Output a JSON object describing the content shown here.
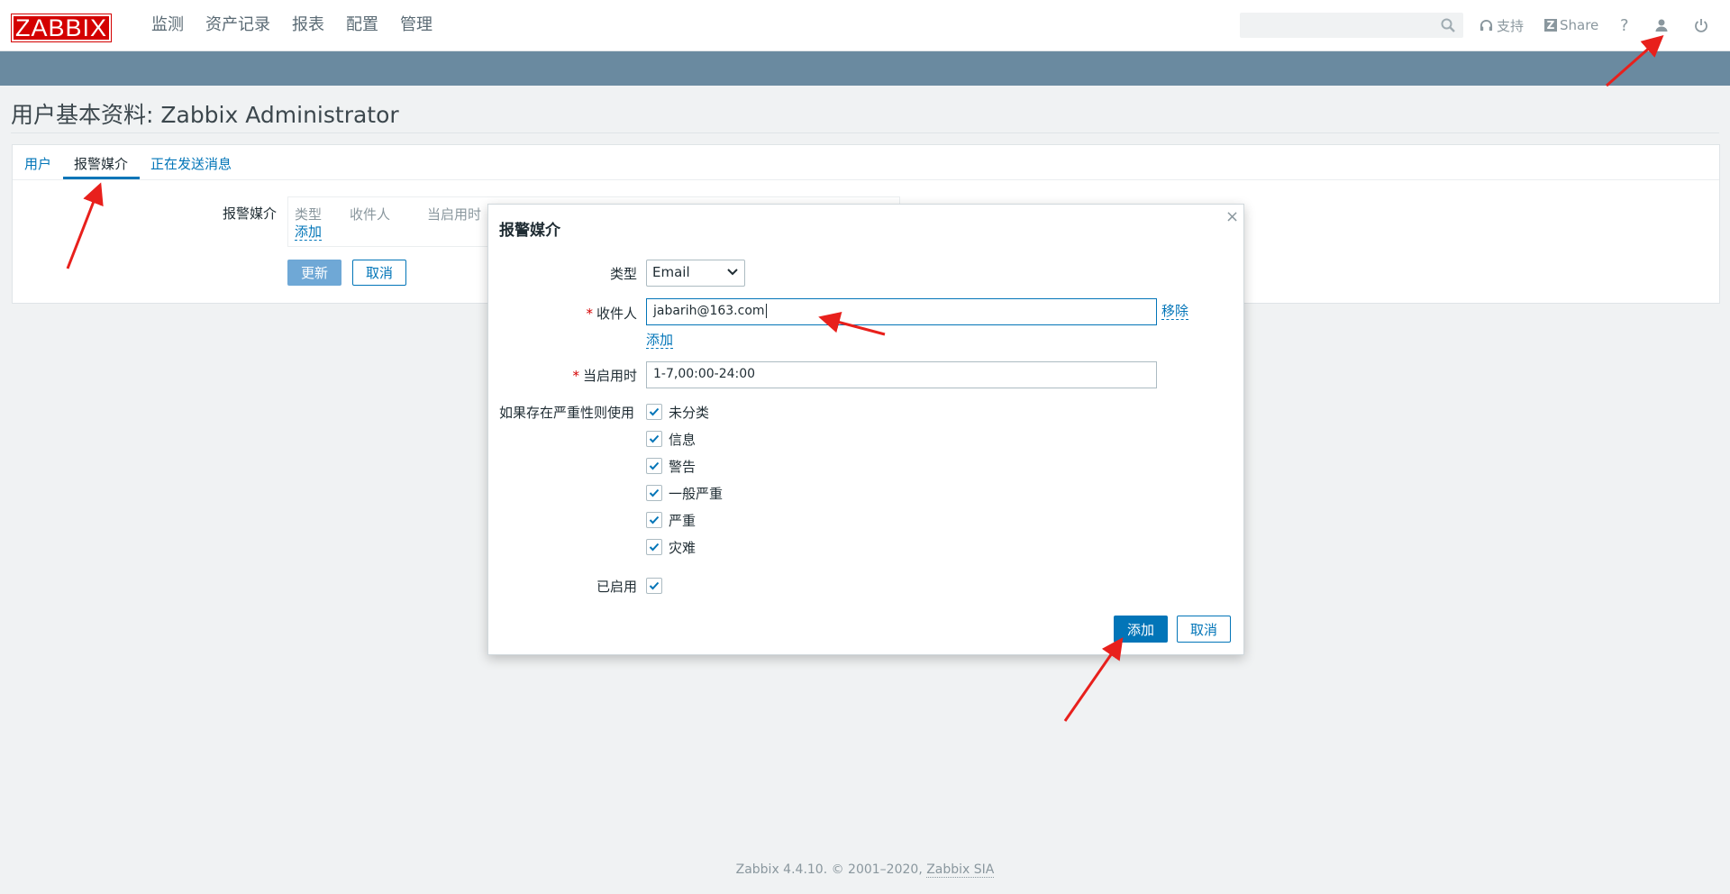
{
  "header": {
    "logo": "ZABBIX",
    "nav": [
      "监测",
      "资产记录",
      "报表",
      "配置",
      "管理"
    ],
    "search_placeholder": "",
    "support": "支持",
    "share": "Share",
    "help": "?"
  },
  "page": {
    "title": "用户基本资料: Zabbix Administrator"
  },
  "tabs": [
    "用户",
    "报警媒介",
    "正在发送消息"
  ],
  "media_section": {
    "label": "报警媒介",
    "columns": [
      "类型",
      "收件人",
      "当启用时"
    ],
    "add_link": "添加",
    "update_button": "更新",
    "cancel_button": "取消"
  },
  "dialog": {
    "title": "报警媒介",
    "type_label": "类型",
    "type_value": "Email",
    "recipient_label": "收件人",
    "recipient_value": "jabarih@163.com",
    "remove_link": "移除",
    "add_link": "添加",
    "when_active_label": "当启用时",
    "when_active_value": "1-7,00:00-24:00",
    "severity_label": "如果存在严重性则使用",
    "severities": [
      "未分类",
      "信息",
      "警告",
      "一般严重",
      "严重",
      "灾难"
    ],
    "enabled_label": "已启用",
    "add_button": "添加",
    "cancel_button": "取消"
  },
  "footer": {
    "text": "Zabbix 4.4.10. © 2001–2020, ",
    "link": "Zabbix SIA"
  },
  "colors": {
    "brand_red": "#d40000",
    "accent_blue": "#0275b8",
    "subbar": "#6a8aa0",
    "annotation_arrow": "#e8201c"
  }
}
